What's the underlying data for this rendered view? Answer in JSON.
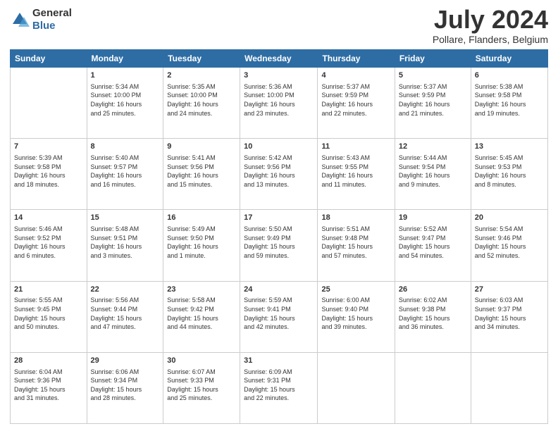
{
  "header": {
    "logo_general": "General",
    "logo_blue": "Blue",
    "title": "July 2024",
    "location": "Pollare, Flanders, Belgium"
  },
  "columns": [
    "Sunday",
    "Monday",
    "Tuesday",
    "Wednesday",
    "Thursday",
    "Friday",
    "Saturday"
  ],
  "weeks": [
    [
      {
        "day": "",
        "content": ""
      },
      {
        "day": "1",
        "content": "Sunrise: 5:34 AM\nSunset: 10:00 PM\nDaylight: 16 hours\nand 25 minutes."
      },
      {
        "day": "2",
        "content": "Sunrise: 5:35 AM\nSunset: 10:00 PM\nDaylight: 16 hours\nand 24 minutes."
      },
      {
        "day": "3",
        "content": "Sunrise: 5:36 AM\nSunset: 10:00 PM\nDaylight: 16 hours\nand 23 minutes."
      },
      {
        "day": "4",
        "content": "Sunrise: 5:37 AM\nSunset: 9:59 PM\nDaylight: 16 hours\nand 22 minutes."
      },
      {
        "day": "5",
        "content": "Sunrise: 5:37 AM\nSunset: 9:59 PM\nDaylight: 16 hours\nand 21 minutes."
      },
      {
        "day": "6",
        "content": "Sunrise: 5:38 AM\nSunset: 9:58 PM\nDaylight: 16 hours\nand 19 minutes."
      }
    ],
    [
      {
        "day": "7",
        "content": "Sunrise: 5:39 AM\nSunset: 9:58 PM\nDaylight: 16 hours\nand 18 minutes."
      },
      {
        "day": "8",
        "content": "Sunrise: 5:40 AM\nSunset: 9:57 PM\nDaylight: 16 hours\nand 16 minutes."
      },
      {
        "day": "9",
        "content": "Sunrise: 5:41 AM\nSunset: 9:56 PM\nDaylight: 16 hours\nand 15 minutes."
      },
      {
        "day": "10",
        "content": "Sunrise: 5:42 AM\nSunset: 9:56 PM\nDaylight: 16 hours\nand 13 minutes."
      },
      {
        "day": "11",
        "content": "Sunrise: 5:43 AM\nSunset: 9:55 PM\nDaylight: 16 hours\nand 11 minutes."
      },
      {
        "day": "12",
        "content": "Sunrise: 5:44 AM\nSunset: 9:54 PM\nDaylight: 16 hours\nand 9 minutes."
      },
      {
        "day": "13",
        "content": "Sunrise: 5:45 AM\nSunset: 9:53 PM\nDaylight: 16 hours\nand 8 minutes."
      }
    ],
    [
      {
        "day": "14",
        "content": "Sunrise: 5:46 AM\nSunset: 9:52 PM\nDaylight: 16 hours\nand 6 minutes."
      },
      {
        "day": "15",
        "content": "Sunrise: 5:48 AM\nSunset: 9:51 PM\nDaylight: 16 hours\nand 3 minutes."
      },
      {
        "day": "16",
        "content": "Sunrise: 5:49 AM\nSunset: 9:50 PM\nDaylight: 16 hours\nand 1 minute."
      },
      {
        "day": "17",
        "content": "Sunrise: 5:50 AM\nSunset: 9:49 PM\nDaylight: 15 hours\nand 59 minutes."
      },
      {
        "day": "18",
        "content": "Sunrise: 5:51 AM\nSunset: 9:48 PM\nDaylight: 15 hours\nand 57 minutes."
      },
      {
        "day": "19",
        "content": "Sunrise: 5:52 AM\nSunset: 9:47 PM\nDaylight: 15 hours\nand 54 minutes."
      },
      {
        "day": "20",
        "content": "Sunrise: 5:54 AM\nSunset: 9:46 PM\nDaylight: 15 hours\nand 52 minutes."
      }
    ],
    [
      {
        "day": "21",
        "content": "Sunrise: 5:55 AM\nSunset: 9:45 PM\nDaylight: 15 hours\nand 50 minutes."
      },
      {
        "day": "22",
        "content": "Sunrise: 5:56 AM\nSunset: 9:44 PM\nDaylight: 15 hours\nand 47 minutes."
      },
      {
        "day": "23",
        "content": "Sunrise: 5:58 AM\nSunset: 9:42 PM\nDaylight: 15 hours\nand 44 minutes."
      },
      {
        "day": "24",
        "content": "Sunrise: 5:59 AM\nSunset: 9:41 PM\nDaylight: 15 hours\nand 42 minutes."
      },
      {
        "day": "25",
        "content": "Sunrise: 6:00 AM\nSunset: 9:40 PM\nDaylight: 15 hours\nand 39 minutes."
      },
      {
        "day": "26",
        "content": "Sunrise: 6:02 AM\nSunset: 9:38 PM\nDaylight: 15 hours\nand 36 minutes."
      },
      {
        "day": "27",
        "content": "Sunrise: 6:03 AM\nSunset: 9:37 PM\nDaylight: 15 hours\nand 34 minutes."
      }
    ],
    [
      {
        "day": "28",
        "content": "Sunrise: 6:04 AM\nSunset: 9:36 PM\nDaylight: 15 hours\nand 31 minutes."
      },
      {
        "day": "29",
        "content": "Sunrise: 6:06 AM\nSunset: 9:34 PM\nDaylight: 15 hours\nand 28 minutes."
      },
      {
        "day": "30",
        "content": "Sunrise: 6:07 AM\nSunset: 9:33 PM\nDaylight: 15 hours\nand 25 minutes."
      },
      {
        "day": "31",
        "content": "Sunrise: 6:09 AM\nSunset: 9:31 PM\nDaylight: 15 hours\nand 22 minutes."
      },
      {
        "day": "",
        "content": ""
      },
      {
        "day": "",
        "content": ""
      },
      {
        "day": "",
        "content": ""
      }
    ]
  ]
}
